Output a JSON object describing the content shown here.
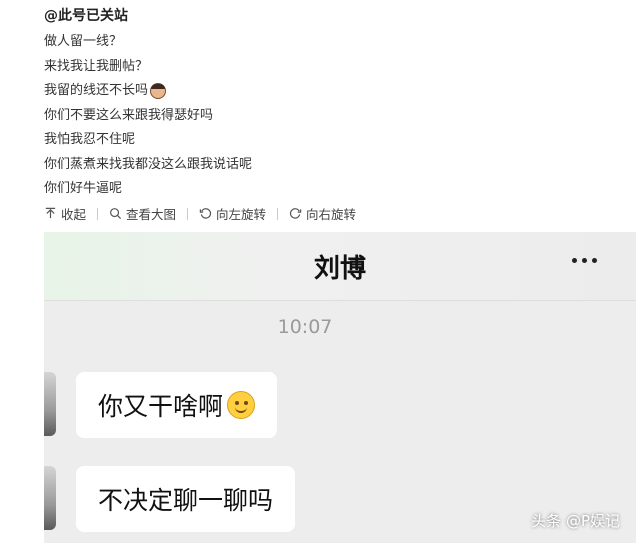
{
  "post": {
    "author": "@此号已关站",
    "lines": [
      "做人留一线？",
      "来找我让我删帖？",
      "我留的线还不长吗",
      "你们不要这么来跟我得瑟好吗",
      "我怕我忍不住呢",
      "你们蒸煮来找我都没这么跟我说话呢",
      "你们好牛逼呢"
    ],
    "actions": {
      "collapse": "收起",
      "view_large": "查看大图",
      "rotate_left": "向左旋转",
      "rotate_right": "向右旋转"
    }
  },
  "chat": {
    "title": "刘博",
    "time": "10:07",
    "messages": [
      {
        "text": "你又干啥啊"
      },
      {
        "text": "不决定聊一聊吗"
      }
    ]
  },
  "watermark": "头条 @P娱记",
  "icons": {
    "collapse": "arrow-up-icon",
    "view_large": "magnifier-icon",
    "rotate_left": "rotate-left-icon",
    "rotate_right": "rotate-right-icon",
    "more": "more-dots-icon",
    "emoji_face": "cartoon-face-icon",
    "smile": "smile-emoji-icon"
  }
}
